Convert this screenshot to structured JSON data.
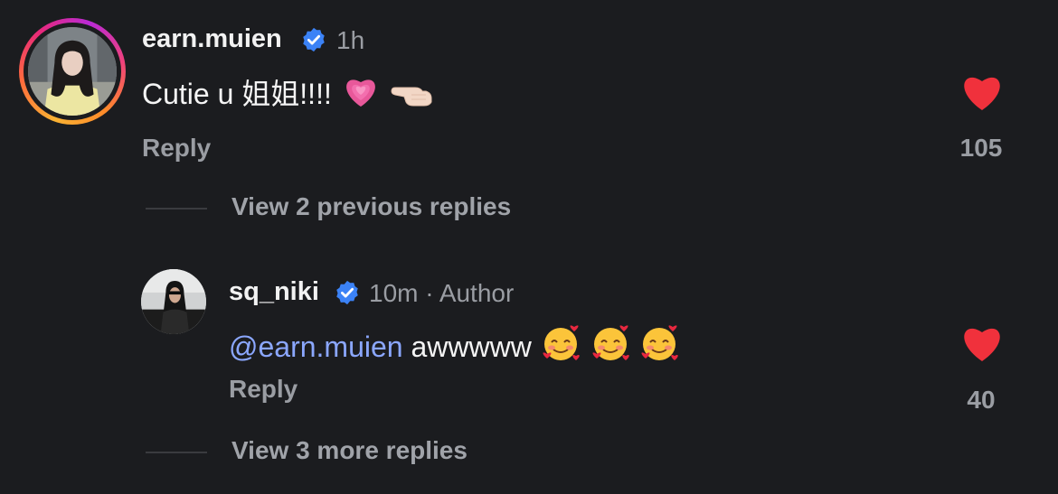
{
  "comment": {
    "username": "earn.muien",
    "time": "1h",
    "text": "Cutie u 姐姐!!!!",
    "emojis": [
      "growing-heart",
      "pointing-hand"
    ],
    "reply_label": "Reply",
    "likes": "105",
    "view_previous_label": "View 2 previous replies"
  },
  "reply": {
    "username": "sq_niki",
    "time": "10m",
    "separator": "·",
    "author_label": "Author",
    "mention": "@earn.muien",
    "text": "awwwww",
    "emojis": [
      "smiling-face-with-hearts",
      "smiling-face-with-hearts",
      "smiling-face-with-hearts"
    ],
    "reply_label": "Reply",
    "likes": "40",
    "view_more_label": "View 3 more replies"
  },
  "colors": {
    "background": "#1b1c1f",
    "like_red": "#f0313c",
    "verified_blue": "#3b82f6",
    "mention_blue": "#8ba7ff",
    "muted_text": "#9a9da3"
  }
}
